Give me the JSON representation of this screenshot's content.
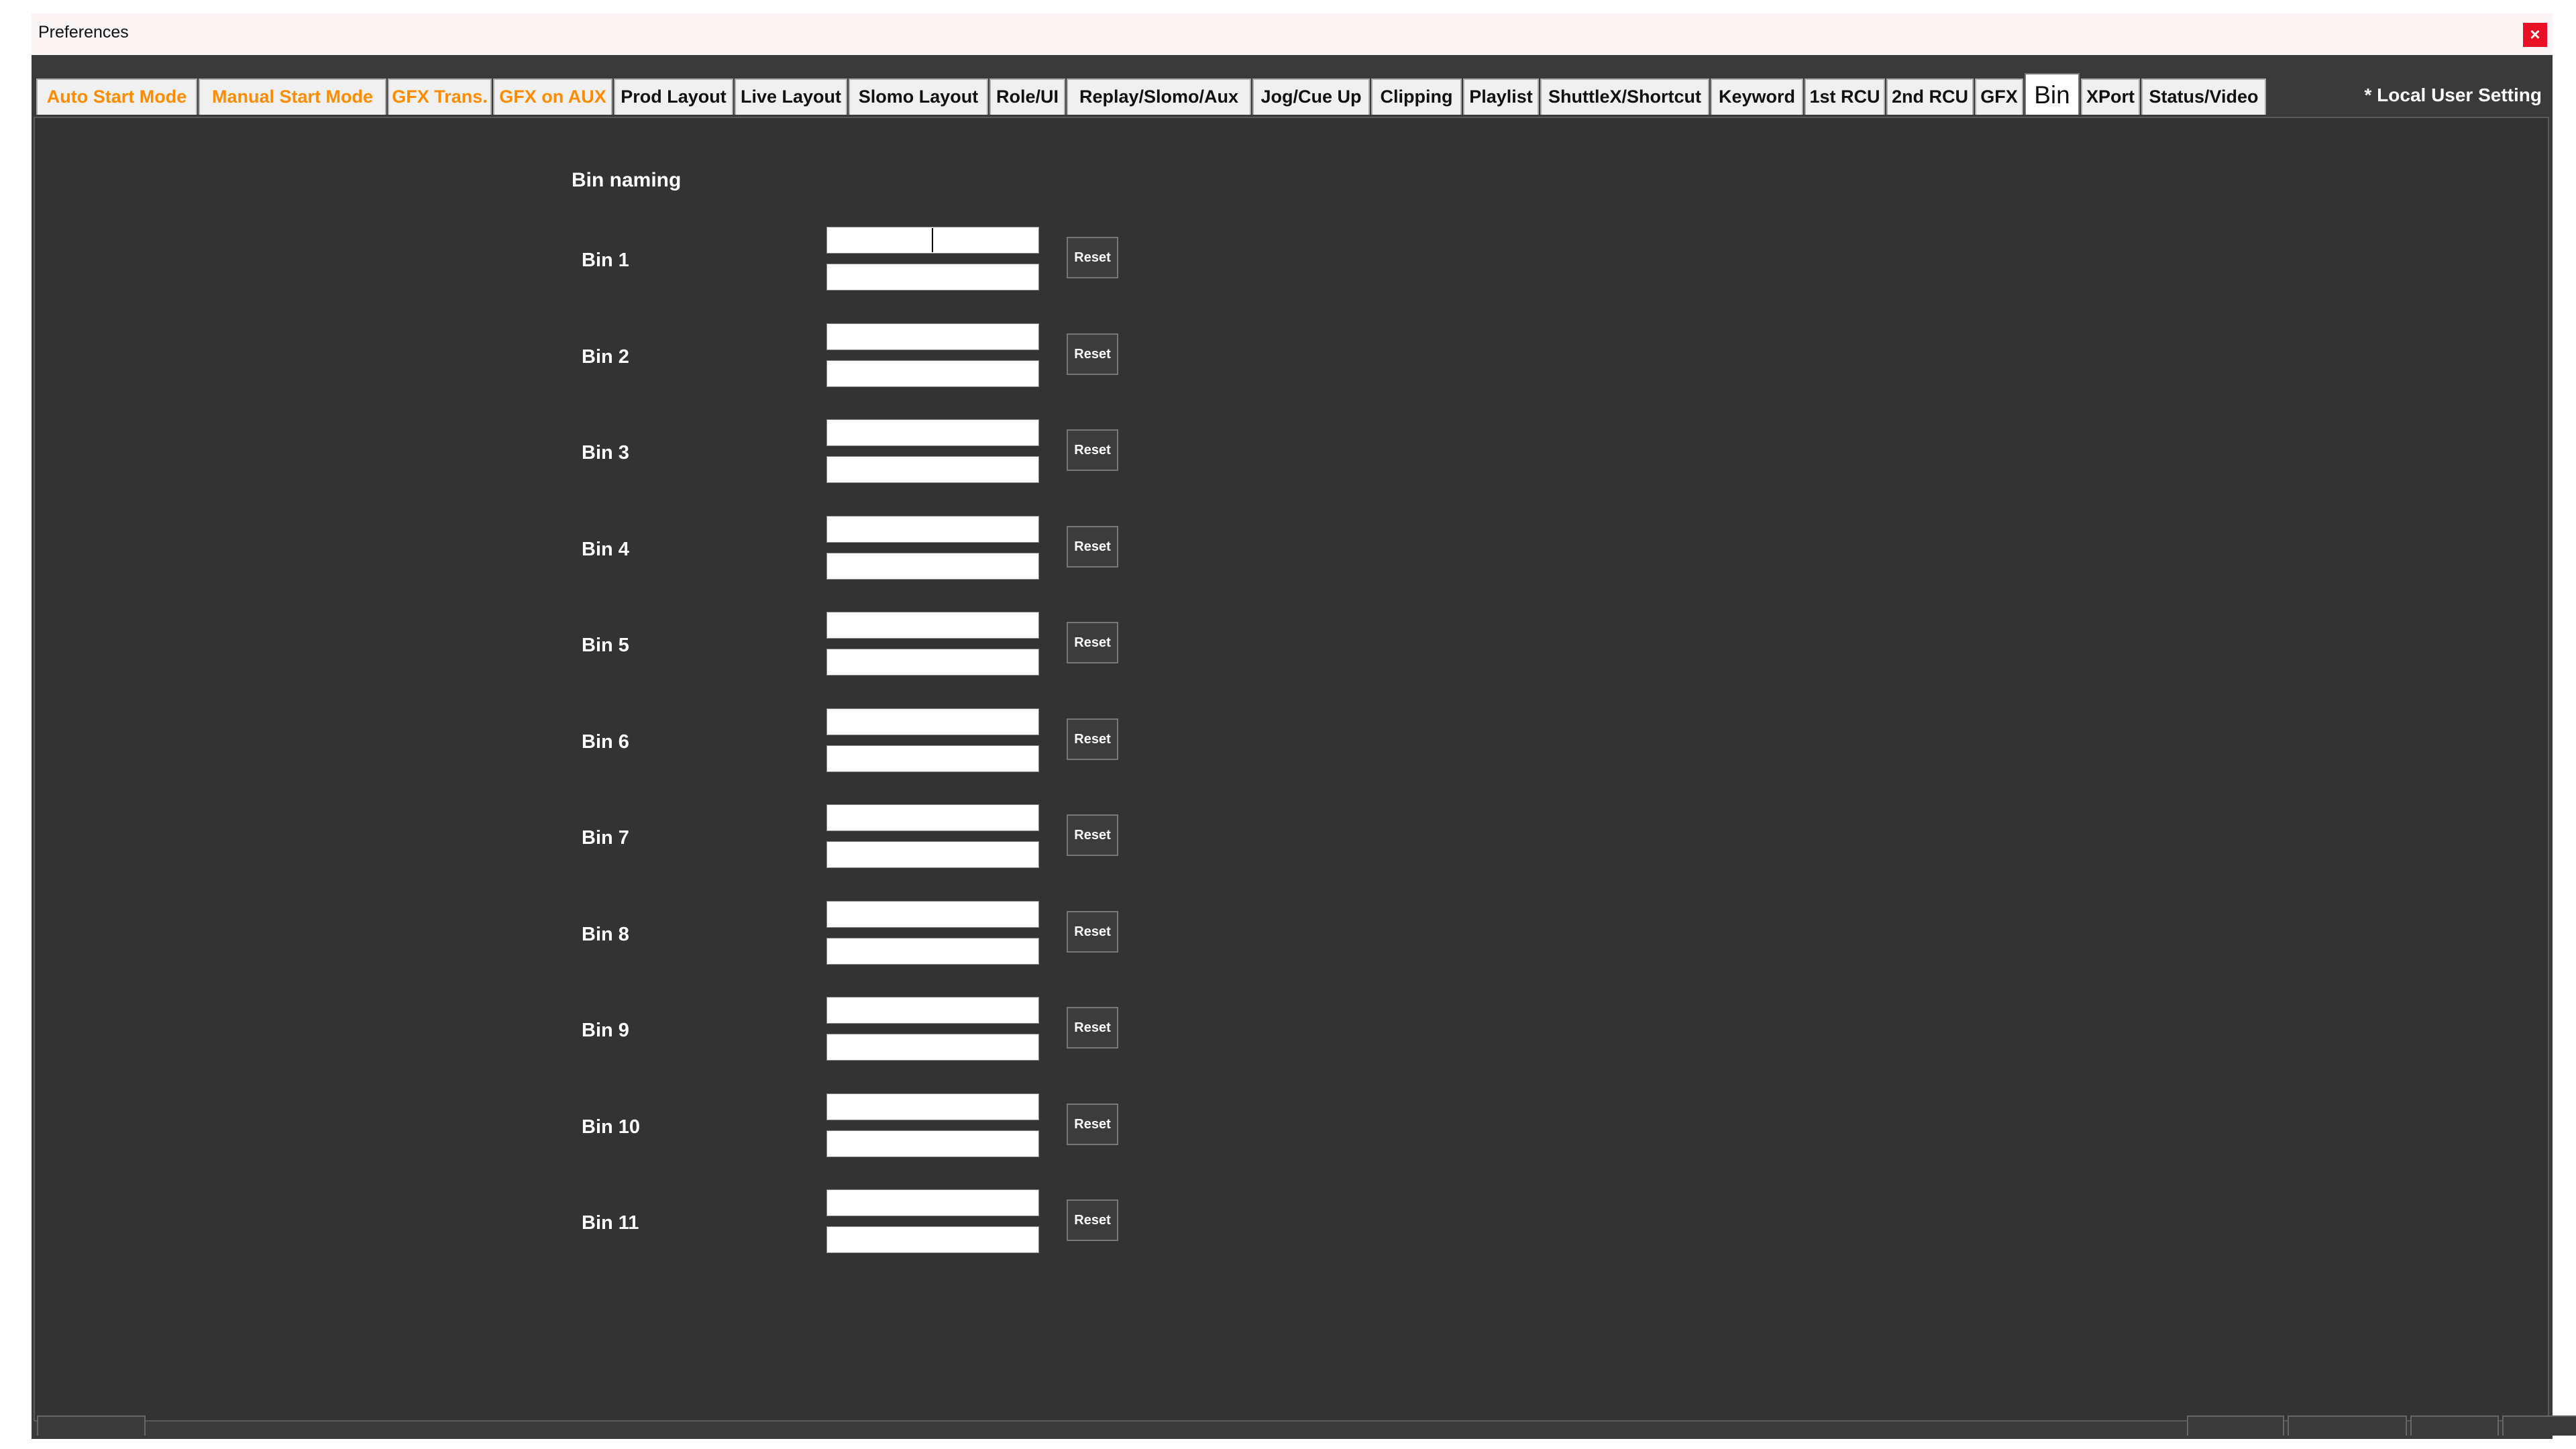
{
  "window": {
    "title": "Preferences",
    "close_label": "×"
  },
  "tabs": [
    {
      "label": "Auto Start Mode",
      "style": "orange"
    },
    {
      "label": "Manual Start Mode",
      "style": "orange"
    },
    {
      "label": "GFX Trans.",
      "style": "orange"
    },
    {
      "label": "GFX on AUX",
      "style": "orange"
    },
    {
      "label": "Prod Layout",
      "style": "normal"
    },
    {
      "label": "Live Layout",
      "style": "normal"
    },
    {
      "label": "Slomo Layout",
      "style": "normal"
    },
    {
      "label": "Role/UI",
      "style": "normal"
    },
    {
      "label": "Replay/Slomo/Aux",
      "style": "normal"
    },
    {
      "label": "Jog/Cue Up",
      "style": "normal"
    },
    {
      "label": "Clipping",
      "style": "normal"
    },
    {
      "label": "Playlist",
      "style": "normal"
    },
    {
      "label": "ShuttleX/Shortcut",
      "style": "normal"
    },
    {
      "label": "Keyword",
      "style": "normal"
    },
    {
      "label": "1st RCU",
      "style": "normal"
    },
    {
      "label": "2nd RCU",
      "style": "normal"
    },
    {
      "label": "GFX",
      "style": "normal"
    },
    {
      "label": "Bin",
      "style": "active"
    },
    {
      "label": "XPort",
      "style": "normal"
    },
    {
      "label": "Status/Video",
      "style": "normal"
    }
  ],
  "local_setting": "* Local User Setting",
  "section_title": "Bin naming",
  "bins": [
    {
      "label": "Bin 1",
      "value_1": "",
      "value_2": ""
    },
    {
      "label": "Bin 2",
      "value_1": "",
      "value_2": ""
    },
    {
      "label": "Bin 3",
      "value_1": "",
      "value_2": ""
    },
    {
      "label": "Bin 4",
      "value_1": "",
      "value_2": ""
    },
    {
      "label": "Bin 5",
      "value_1": "",
      "value_2": ""
    },
    {
      "label": "Bin 6",
      "value_1": "",
      "value_2": ""
    },
    {
      "label": "Bin 7",
      "value_1": "",
      "value_2": ""
    },
    {
      "label": "Bin 8",
      "value_1": "",
      "value_2": ""
    },
    {
      "label": "Bin 9",
      "value_1": "",
      "value_2": ""
    },
    {
      "label": "Bin 10",
      "value_1": "",
      "value_2": ""
    },
    {
      "label": "Bin 11",
      "value_1": "",
      "value_2": ""
    }
  ],
  "reset_label": "Reset",
  "colors": {
    "accent_orange": "#ff8c00",
    "panel_bg": "#333333",
    "close_red": "#e81123"
  }
}
